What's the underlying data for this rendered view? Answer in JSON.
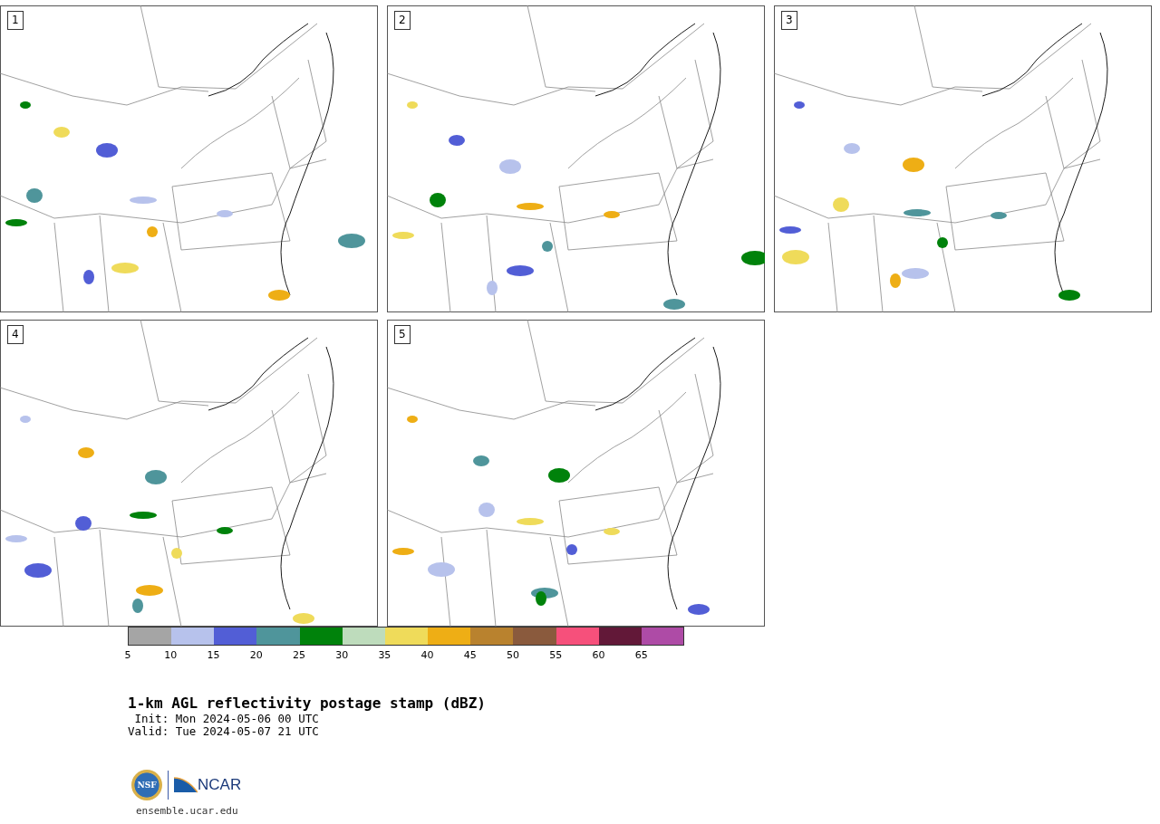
{
  "panels": [
    {
      "label": "1"
    },
    {
      "label": "2"
    },
    {
      "label": "3"
    },
    {
      "label": "4"
    },
    {
      "label": "5"
    }
  ],
  "colorbar": {
    "bins": [
      {
        "color": "#a5a5a5"
      },
      {
        "color": "#b7c2ec"
      },
      {
        "color": "#525ed6"
      },
      {
        "color": "#4f959b"
      },
      {
        "color": "#00820b"
      },
      {
        "color": "#bedcbc"
      },
      {
        "color": "#efdb5a"
      },
      {
        "color": "#eeae15"
      },
      {
        "color": "#b9822e"
      },
      {
        "color": "#8a5a3d"
      },
      {
        "color": "#f6507b"
      },
      {
        "color": "#621838"
      },
      {
        "color": "#ae4ba6"
      }
    ],
    "ticks": [
      "5",
      "10",
      "15",
      "20",
      "25",
      "30",
      "35",
      "40",
      "45",
      "50",
      "55",
      "60",
      "65"
    ]
  },
  "title": "1-km AGL reflectivity postage stamp (dBZ)",
  "init": " Init: Mon 2024-05-06 00 UTC",
  "valid": "Valid: Tue 2024-05-07 21 UTC",
  "logos": {
    "nsf": "NSF",
    "ncar": "NCAR"
  },
  "url": "ensemble.ucar.edu"
}
